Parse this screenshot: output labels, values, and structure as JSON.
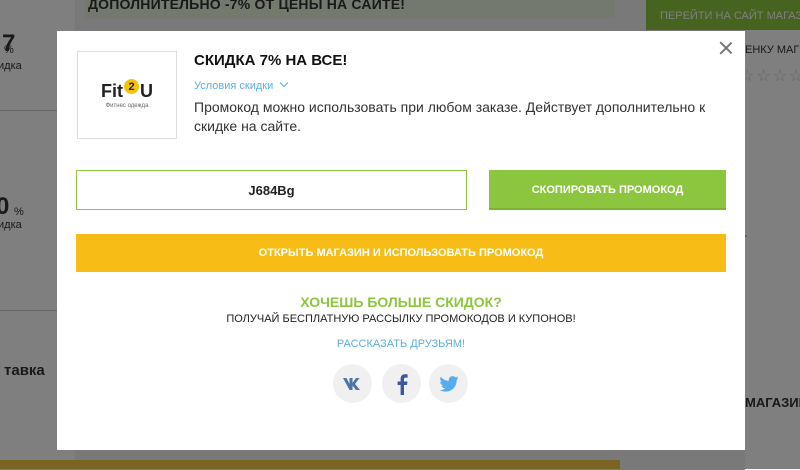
{
  "background": {
    "top_banner": "ДОПОЛНИТЕЛЬНО -7% ОТ ЦЕНЫ НА САЙТЕ!",
    "top_button": "ПЕРЕЙТИ НА САЙТ МАГАЗИНА",
    "left_values": [
      "7",
      "0"
    ],
    "left_suffix": "%",
    "left_sub": "идка",
    "left_label": "тавка",
    "right_text1": "ЕНКУ МАГ",
    "right_stars": "☆☆☆☆",
    "right_text2": "–",
    "right_text3": "МАГАЗИН"
  },
  "modal": {
    "close_label": "×",
    "logo": {
      "text_left": "Fit",
      "text_circle": "2",
      "text_right": "U",
      "subtitle": "Фитнес одежда"
    },
    "title": "СКИДКА 7% НА ВСЕ!",
    "terms_label": "Условия скидки",
    "description": "Промокод можно использовать при любом заказе. Действует дополнительно к скидке на сайте.",
    "promo_code": "J684Bg",
    "copy_button": "СКОПИРОВАТЬ ПРОМОКОД",
    "open_button": "ОТКРЫТЬ МАГАЗИН И ИСПОЛЬЗОВАТЬ ПРОМОКОД",
    "promo_heading": "ХОЧЕШЬ БОЛЬШЕ СКИДОК?",
    "promo_sub": "ПОЛУЧАЙ БЕСПЛАТНУЮ РАССЫЛКУ ПРОМОКОДОВ И КУПОНОВ!",
    "share_link": "РАССКАЗАТЬ ДРУЗЬЯМ!",
    "social": [
      {
        "name": "vk-icon",
        "color": "#4a76a8"
      },
      {
        "name": "facebook-icon",
        "color": "#3b5998"
      },
      {
        "name": "twitter-icon",
        "color": "#55acee"
      }
    ],
    "colors": {
      "green": "#8cc63f",
      "yellow": "#f7bd16",
      "link": "#5aaedf"
    }
  }
}
